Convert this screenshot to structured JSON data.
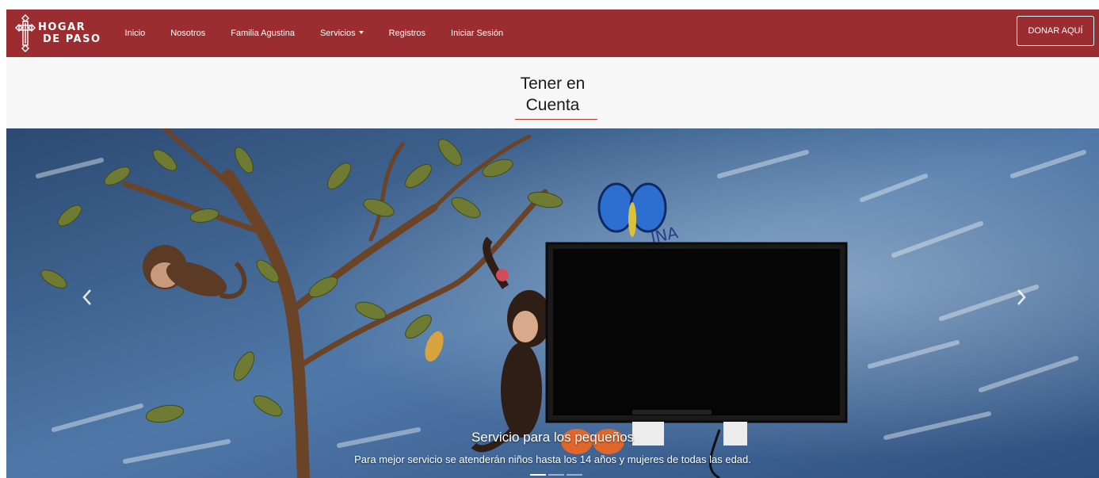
{
  "navbar": {
    "brand_line1": "HOGAR",
    "brand_line2": "DE PASO",
    "links": [
      "Inicio",
      "Nosotros",
      "Familia Agustina",
      "Servicios",
      "Registros",
      "Iniciar Sesión"
    ],
    "donate_label": "DONAR AQUÍ",
    "bg_color": "#9b2d30"
  },
  "heading": {
    "line1": "Tener en",
    "line2": "Cuenta",
    "underline_color": "#c0392b"
  },
  "carousel": {
    "prev_icon": "chevron-left-icon",
    "next_icon": "chevron-right-icon",
    "caption_title": "Servicio para los pequeños",
    "caption_text": "Para mejor servicio se atenderán niños hasta los 14 años y mujeres de todas las edad.",
    "mural_text": "INA",
    "indicator_count": 3,
    "active_index": 0
  }
}
